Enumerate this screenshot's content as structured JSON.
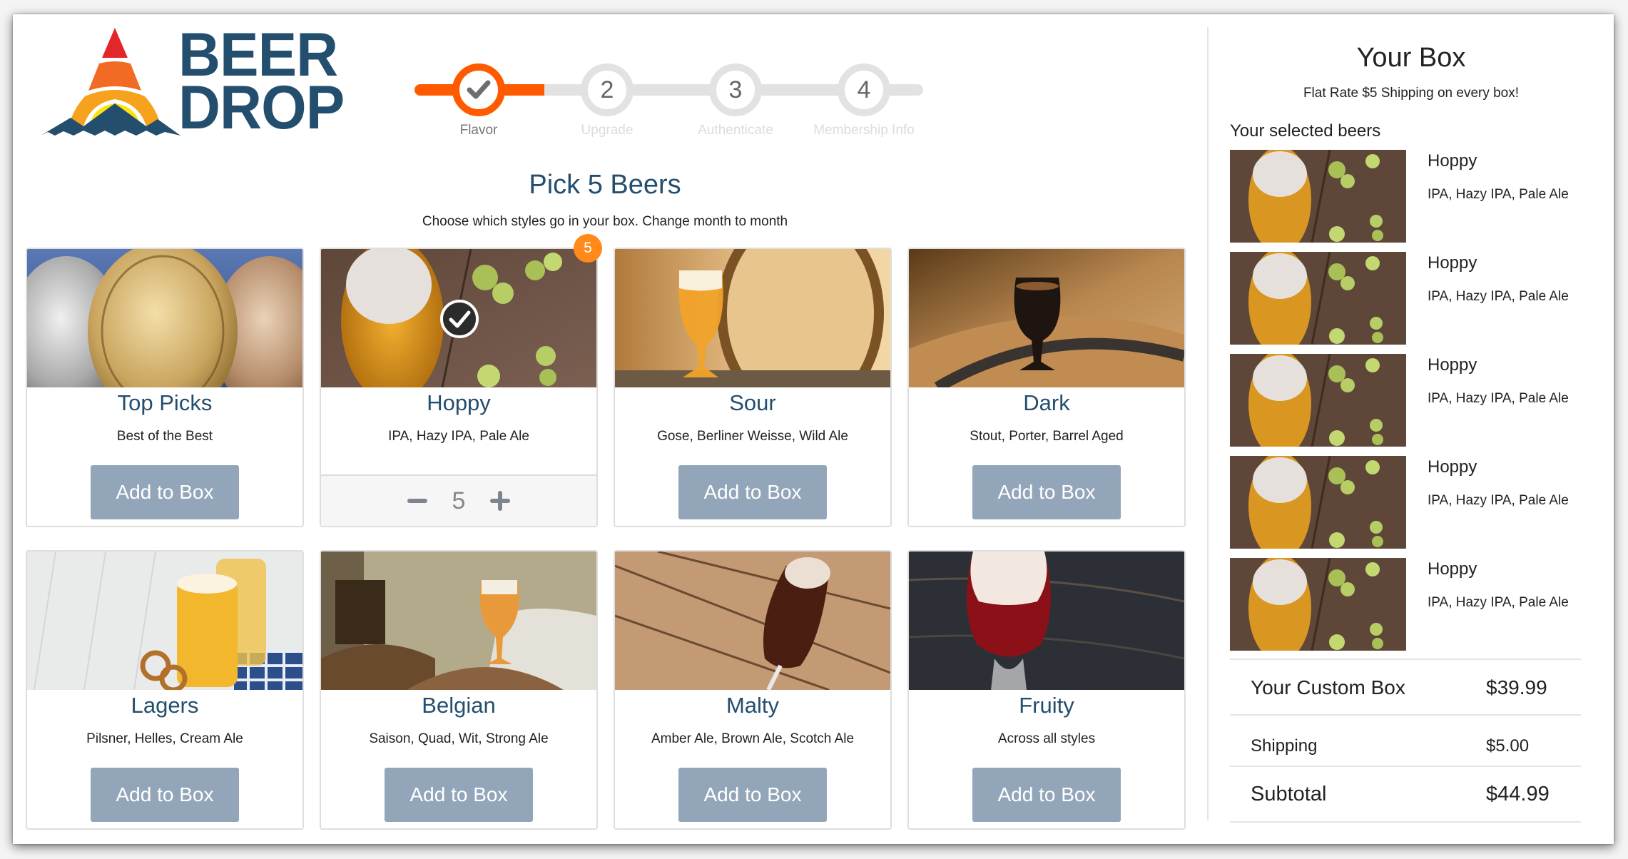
{
  "brand": {
    "name_line1": "BEER",
    "name_line2": "DROP",
    "colors": {
      "navy": "#244e6e",
      "red": "#e3262a",
      "orange": "#f26b25",
      "amber": "#f7a21c",
      "yellow": "#fde30b"
    }
  },
  "stepper": {
    "steps": [
      {
        "number": "1",
        "label": "Flavor",
        "state": "complete",
        "icon": "check-icon"
      },
      {
        "number": "2",
        "label": "Upgrade",
        "state": "pending"
      },
      {
        "number": "3",
        "label": "Authenticate",
        "state": "pending"
      },
      {
        "number": "4",
        "label": "Membership Info",
        "state": "pending"
      }
    ],
    "accent_color": "#ff5a00"
  },
  "main": {
    "title": "Pick 5 Beers",
    "subtitle": "Choose which styles go in your box. Change month to month",
    "add_label": "Add to Box",
    "cards": [
      {
        "title": "Top Picks",
        "description": "Best of the Best",
        "selected": false,
        "image": "medals"
      },
      {
        "title": "Hoppy",
        "description": "IPA, Hazy IPA, Pale Ale",
        "selected": true,
        "quantity": "5",
        "badge": "5",
        "image": "ipa-hops"
      },
      {
        "title": "Sour",
        "description": "Gose, Berliner Weisse, Wild Ale",
        "selected": false,
        "image": "sour-glass-barrel"
      },
      {
        "title": "Dark",
        "description": "Stout, Porter, Barrel Aged",
        "selected": false,
        "image": "stout-barrel"
      },
      {
        "title": "Lagers",
        "description": "Pilsner, Helles, Cream Ale",
        "selected": false,
        "image": "lager-mugs"
      },
      {
        "title": "Belgian",
        "description": "Saison, Quad, Wit, Strong Ale",
        "selected": false,
        "image": "belgian-tulip"
      },
      {
        "title": "Malty",
        "description": "Amber Ale, Brown Ale, Scotch Ale",
        "selected": false,
        "image": "malty-glass-wood"
      },
      {
        "title": "Fruity",
        "description": "Across all styles",
        "selected": false,
        "image": "fruity-red-glass"
      }
    ]
  },
  "sidebar": {
    "title": "Your Box",
    "subtitle": "Flat Rate $5 Shipping on every box!",
    "selected_heading": "Your selected beers",
    "items": [
      {
        "name": "Hoppy",
        "styles": "IPA, Hazy IPA, Pale Ale"
      },
      {
        "name": "Hoppy",
        "styles": "IPA, Hazy IPA, Pale Ale"
      },
      {
        "name": "Hoppy",
        "styles": "IPA, Hazy IPA, Pale Ale"
      },
      {
        "name": "Hoppy",
        "styles": "IPA, Hazy IPA, Pale Ale"
      },
      {
        "name": "Hoppy",
        "styles": "IPA, Hazy IPA, Pale Ale"
      }
    ],
    "totals": [
      {
        "label": "Your Custom Box",
        "value": "$39.99"
      },
      {
        "label": "Shipping",
        "value": "$5.00"
      },
      {
        "label": "Subtotal",
        "value": "$44.99"
      }
    ]
  }
}
